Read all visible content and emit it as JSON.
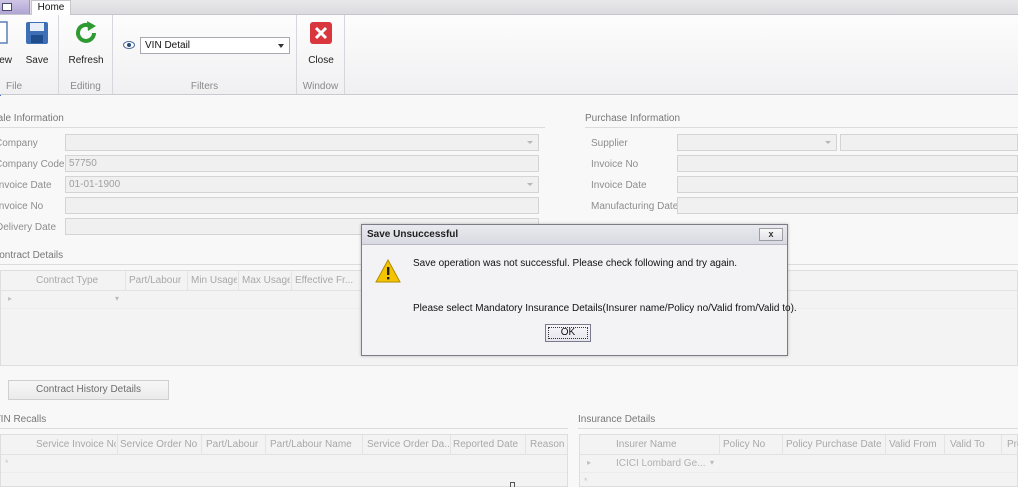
{
  "ribbon": {
    "home_tab": "Home",
    "groups": {
      "file": {
        "label": "File",
        "new_label": "New",
        "save_label": "Save"
      },
      "editing": {
        "label": "Editing",
        "refresh_label": "Refresh"
      },
      "filters": {
        "label": "Filters",
        "combo_value": "VIN Detail"
      },
      "window": {
        "label": "Window",
        "close_label": "Close"
      }
    }
  },
  "sale_info": {
    "title": "Sale Information",
    "company_label": "Company",
    "company_value": "",
    "company_code_label": "Company Code",
    "company_code_value": "57750",
    "invoice_date_label": "Invoice Date",
    "invoice_date_value": "01-01-1900",
    "invoice_no_label": "Invoice No",
    "invoice_no_value": "",
    "delivery_date_label": "Delivery Date",
    "delivery_date_value": ""
  },
  "purchase_info": {
    "title": "Purchase Information",
    "supplier_label": "Supplier",
    "invoice_no_label": "Invoice No",
    "invoice_date_label": "Invoice Date",
    "manufacturing_date_label": "Manufacturing Date"
  },
  "contract": {
    "title": "Contract Details",
    "columns": [
      "Contract Type",
      "Part/Labour",
      "Min Usage",
      "Max Usage",
      "Effective Fr..."
    ],
    "history_button": "Contract History Details"
  },
  "recalls": {
    "title": "VIN Recalls",
    "columns": [
      "Service Invoice No",
      "Service Order No",
      "Part/Labour",
      "Part/Labour Name",
      "Service Order Da...",
      "Reported Date",
      "Reason"
    ]
  },
  "insurance": {
    "title": "Insurance Details",
    "columns": [
      "Insurer Name",
      "Policy No",
      "Policy Purchase Date",
      "Valid From",
      "Valid To",
      "Pre"
    ],
    "row1_insurer": "ICICI Lombard Ge..."
  },
  "dialog": {
    "title": "Save Unsuccessful",
    "close_glyph": "x",
    "message1": "Save operation was not successful. Please check following and try again.",
    "message2": "Please select Mandatory Insurance Details(Insurer name/Policy no/Valid from/Valid to).",
    "ok_label": "OK"
  },
  "colors": {
    "close_icon_red": "#d9363e",
    "refresh_green": "#2f9a32",
    "warning_yellow": "#f5c400",
    "save_blue": "#3d6fb6"
  }
}
